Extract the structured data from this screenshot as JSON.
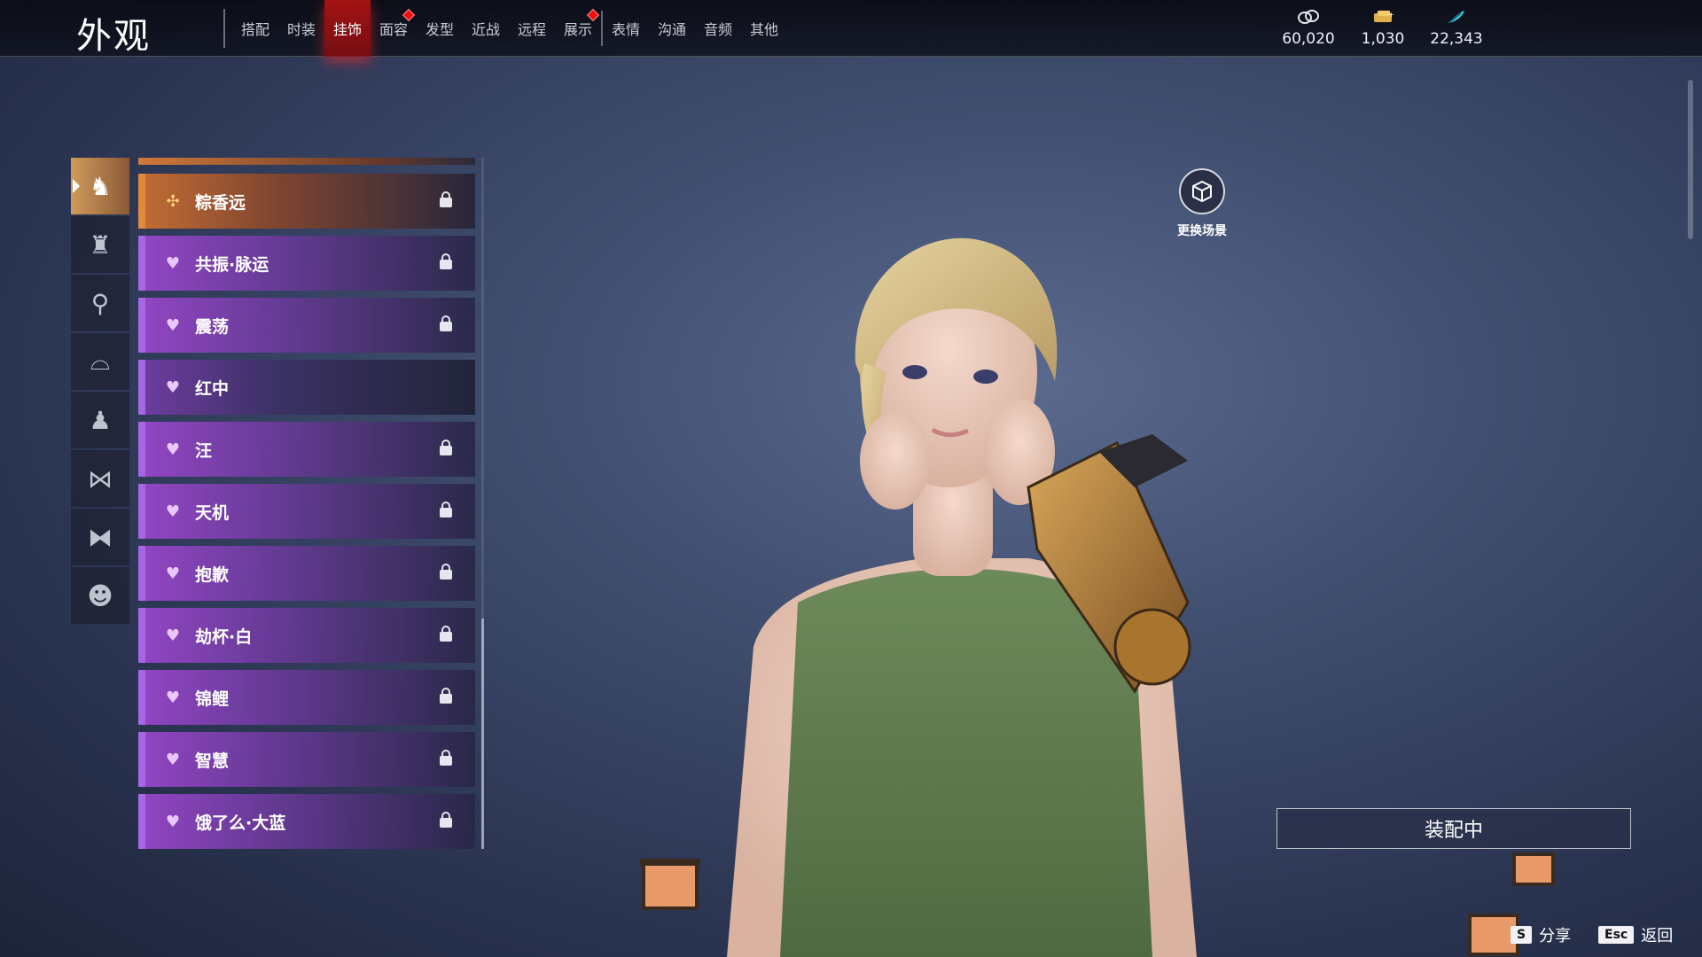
{
  "header": {
    "title": "外观",
    "tabs": [
      {
        "label": "搭配",
        "active": false,
        "dot": false
      },
      {
        "label": "时装",
        "active": false,
        "dot": false
      },
      {
        "label": "挂饰",
        "active": true,
        "dot": false
      },
      {
        "label": "面容",
        "active": false,
        "dot": true
      },
      {
        "label": "发型",
        "active": false,
        "dot": false
      },
      {
        "label": "近战",
        "active": false,
        "dot": false
      },
      {
        "label": "远程",
        "active": false,
        "dot": false
      },
      {
        "label": "展示",
        "active": false,
        "dot": true
      },
      {
        "label": "表情",
        "active": false,
        "dot": false
      },
      {
        "label": "沟通",
        "active": false,
        "dot": false
      },
      {
        "label": "音频",
        "active": false,
        "dot": false
      },
      {
        "label": "其他",
        "active": false,
        "dot": false
      }
    ],
    "currencies": [
      {
        "icon": "coin-stack-icon",
        "value": "60,020"
      },
      {
        "icon": "gold-ticket-icon",
        "value": "1,030"
      },
      {
        "icon": "feather-icon",
        "value": "22,343"
      }
    ]
  },
  "rail": [
    {
      "icon": "helmet-icon",
      "active": true
    },
    {
      "icon": "hat-icon",
      "active": false
    },
    {
      "icon": "hairpin-icon",
      "active": false
    },
    {
      "icon": "mask-icon",
      "active": false
    },
    {
      "icon": "cape-icon",
      "active": false
    },
    {
      "icon": "bow-icon",
      "active": false
    },
    {
      "icon": "waist-icon",
      "active": false
    },
    {
      "icon": "demon-face-icon",
      "active": false
    }
  ],
  "list": [
    {
      "name": "粽香远",
      "rarity": "gold",
      "locked": true
    },
    {
      "name": "共振·脉运",
      "rarity": "purple",
      "locked": true
    },
    {
      "name": "震荡",
      "rarity": "purple",
      "locked": true
    },
    {
      "name": "红中",
      "rarity": "plain",
      "locked": false
    },
    {
      "name": "汪",
      "rarity": "purple",
      "locked": true
    },
    {
      "name": "天机",
      "rarity": "purple",
      "locked": true
    },
    {
      "name": "抱歉",
      "rarity": "purple",
      "locked": true
    },
    {
      "name": "劫杯·白",
      "rarity": "purple",
      "locked": true
    },
    {
      "name": "锦鲤",
      "rarity": "purple",
      "locked": true
    },
    {
      "name": "智慧",
      "rarity": "purple",
      "locked": true
    },
    {
      "name": "饿了么·大蓝",
      "rarity": "purple",
      "locked": true
    }
  ],
  "scene": {
    "change_scene_label": "更换场景"
  },
  "equip_label": "装配中",
  "hints": {
    "share_key": "S",
    "share_label": "分享",
    "back_key": "Esc",
    "back_label": "返回"
  },
  "colors": {
    "active_tab": "#c01414",
    "gold_rarity": "#e08a3a",
    "purple_rarity": "#a566e8"
  }
}
